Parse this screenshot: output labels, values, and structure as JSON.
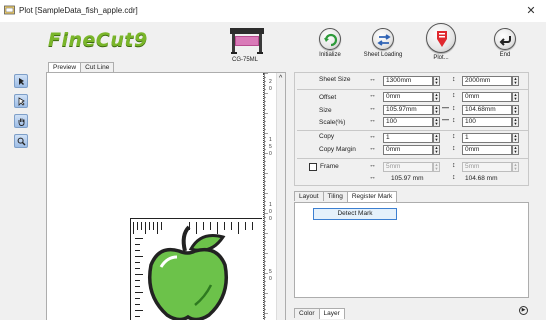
{
  "window": {
    "title": "Plot [SampleData_fish_apple.cdr]",
    "close_glyph": "✕"
  },
  "logo": {
    "text": "FineCut9"
  },
  "machine": {
    "label": "CG-75ML"
  },
  "toolbar": {
    "buttons": [
      {
        "label": "Initialize",
        "icon": "refresh-icon"
      },
      {
        "label": "Sheet Loading",
        "icon": "swap-arrows-icon"
      },
      {
        "label": "Plot...",
        "icon": "plotter-icon"
      },
      {
        "label": "End",
        "icon": "return-arrow-icon"
      }
    ]
  },
  "left_tabs": [
    {
      "label": "Preview",
      "active": true
    },
    {
      "label": "Cut Line",
      "active": false
    }
  ],
  "ruler": {
    "marks": [
      "2",
      "1\n5",
      "1\n0",
      "5"
    ]
  },
  "settings": {
    "sheet_size": {
      "label": "Sheet Size",
      "width": "1300mm",
      "height": "2000mm"
    },
    "offset": {
      "label": "Offset",
      "x": "0mm",
      "y": "0mm"
    },
    "size": {
      "label": "Size",
      "x": "105.97mm",
      "y": "104.68mm"
    },
    "scale": {
      "label": "Scale(%)",
      "x": "100",
      "y": "100"
    },
    "copy": {
      "label": "Copy",
      "x": "1",
      "y": "1"
    },
    "copy_margin": {
      "label": "Copy Margin",
      "x": "0mm",
      "y": "0mm"
    },
    "frame": {
      "label": "Frame",
      "x": "5mm",
      "y": "5mm",
      "checked": false
    },
    "frame_totals": {
      "x": "105.97 mm",
      "y": "104.68 mm"
    },
    "arrows": {
      "horizontal": "↔",
      "vertical": "↕",
      "link": "—"
    }
  },
  "mid_tabs": [
    {
      "label": "Layout",
      "active": false
    },
    {
      "label": "Tiling",
      "active": false
    },
    {
      "label": "Register Mark",
      "active": true
    }
  ],
  "register_mark": {
    "detect_label": "Detect Mark"
  },
  "bottom_tabs": [
    {
      "label": "Color",
      "active": false
    },
    {
      "label": "Layer",
      "active": true
    }
  ],
  "colors": {
    "accent": "#3c7fd1",
    "logo_green": "#7ab62a",
    "plot_red": "#e0282e",
    "apple_green": "#6cc24a"
  }
}
